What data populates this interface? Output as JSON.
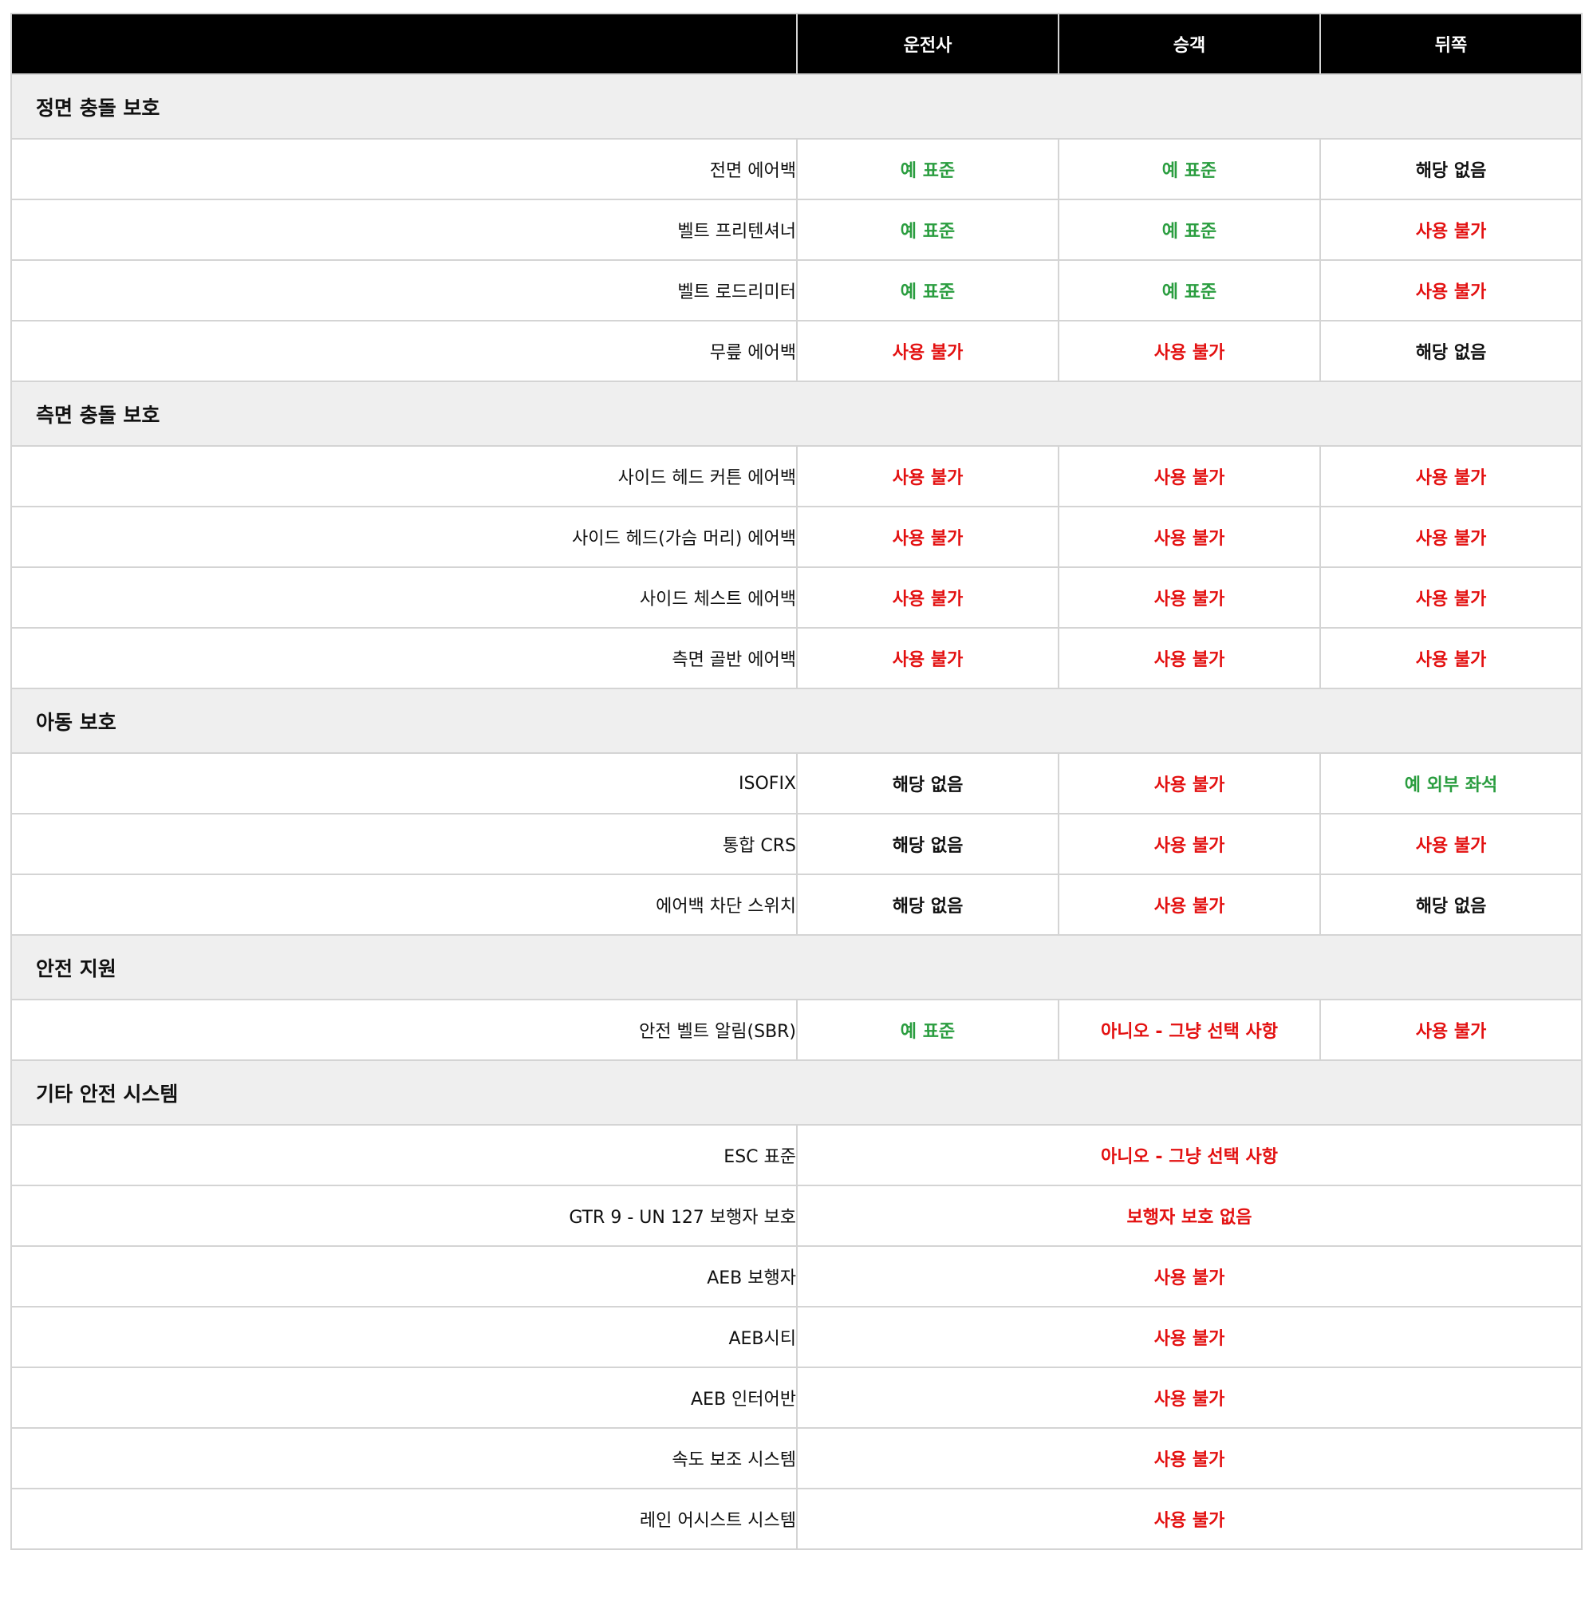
{
  "header": {
    "col1": "",
    "col2": "운전사",
    "col3": "승객",
    "col4": "뒤쪽"
  },
  "colors": {
    "yes": "#2a9d3f",
    "no": "#e31010",
    "na": "#111111"
  },
  "sections": [
    {
      "title": "정면 충돌 보호",
      "rows": [
        {
          "label": "전면 에어백",
          "driver": {
            "text": "예 표준",
            "status": "yes"
          },
          "passenger": {
            "text": "예 표준",
            "status": "yes"
          },
          "rear": {
            "text": "해당 없음",
            "status": "na"
          }
        },
        {
          "label": "벨트 프리텐셔너",
          "driver": {
            "text": "예 표준",
            "status": "yes"
          },
          "passenger": {
            "text": "예 표준",
            "status": "yes"
          },
          "rear": {
            "text": "사용 불가",
            "status": "no"
          }
        },
        {
          "label": "벨트 로드리미터",
          "driver": {
            "text": "예 표준",
            "status": "yes"
          },
          "passenger": {
            "text": "예 표준",
            "status": "yes"
          },
          "rear": {
            "text": "사용 불가",
            "status": "no"
          }
        },
        {
          "label": "무릎 에어백",
          "driver": {
            "text": "사용 불가",
            "status": "no"
          },
          "passenger": {
            "text": "사용 불가",
            "status": "no"
          },
          "rear": {
            "text": "해당 없음",
            "status": "na"
          }
        }
      ]
    },
    {
      "title": "측면 충돌 보호",
      "rows": [
        {
          "label": "사이드 헤드 커튼 에어백",
          "driver": {
            "text": "사용 불가",
            "status": "no"
          },
          "passenger": {
            "text": "사용 불가",
            "status": "no"
          },
          "rear": {
            "text": "사용 불가",
            "status": "no"
          }
        },
        {
          "label": "사이드 헤드(가슴 머리) 에어백",
          "driver": {
            "text": "사용 불가",
            "status": "no"
          },
          "passenger": {
            "text": "사용 불가",
            "status": "no"
          },
          "rear": {
            "text": "사용 불가",
            "status": "no"
          }
        },
        {
          "label": "사이드 체스트 에어백",
          "driver": {
            "text": "사용 불가",
            "status": "no"
          },
          "passenger": {
            "text": "사용 불가",
            "status": "no"
          },
          "rear": {
            "text": "사용 불가",
            "status": "no"
          }
        },
        {
          "label": "측면 골반 에어백",
          "driver": {
            "text": "사용 불가",
            "status": "no"
          },
          "passenger": {
            "text": "사용 불가",
            "status": "no"
          },
          "rear": {
            "text": "사용 불가",
            "status": "no"
          }
        }
      ]
    },
    {
      "title": "아동 보호",
      "rows": [
        {
          "label": "ISOFIX",
          "driver": {
            "text": "해당 없음",
            "status": "na"
          },
          "passenger": {
            "text": "사용 불가",
            "status": "no"
          },
          "rear": {
            "text": "예 외부 좌석",
            "status": "yes"
          }
        },
        {
          "label": "통합 CRS",
          "driver": {
            "text": "해당 없음",
            "status": "na"
          },
          "passenger": {
            "text": "사용 불가",
            "status": "no"
          },
          "rear": {
            "text": "사용 불가",
            "status": "no"
          }
        },
        {
          "label": "에어백 차단 스위치",
          "driver": {
            "text": "해당 없음",
            "status": "na"
          },
          "passenger": {
            "text": "사용 불가",
            "status": "no"
          },
          "rear": {
            "text": "해당 없음",
            "status": "na"
          }
        }
      ]
    },
    {
      "title": "안전 지원",
      "rows": [
        {
          "label": "안전 벨트 알림(SBR)",
          "driver": {
            "text": "예 표준",
            "status": "yes"
          },
          "passenger": {
            "text": "아니오 - 그냥 선택 사항",
            "status": "no"
          },
          "rear": {
            "text": "사용 불가",
            "status": "no"
          }
        }
      ]
    },
    {
      "title": "기타 안전 시스템",
      "rows": [
        {
          "label": "ESC 표준",
          "span": {
            "text": "아니오 - 그냥 선택 사항",
            "status": "no"
          }
        },
        {
          "label": "GTR 9 - UN 127 보행자 보호",
          "span": {
            "text": "보행자 보호 없음",
            "status": "no"
          }
        },
        {
          "label": "AEB 보행자",
          "span": {
            "text": "사용 불가",
            "status": "no"
          }
        },
        {
          "label": "AEB시티",
          "span": {
            "text": "사용 불가",
            "status": "no"
          }
        },
        {
          "label": "AEB 인터어반",
          "span": {
            "text": "사용 불가",
            "status": "no"
          }
        },
        {
          "label": "속도 보조 시스템",
          "span": {
            "text": "사용 불가",
            "status": "no"
          }
        },
        {
          "label": "레인 어시스트 시스템",
          "span": {
            "text": "사용 불가",
            "status": "no"
          }
        }
      ]
    }
  ]
}
